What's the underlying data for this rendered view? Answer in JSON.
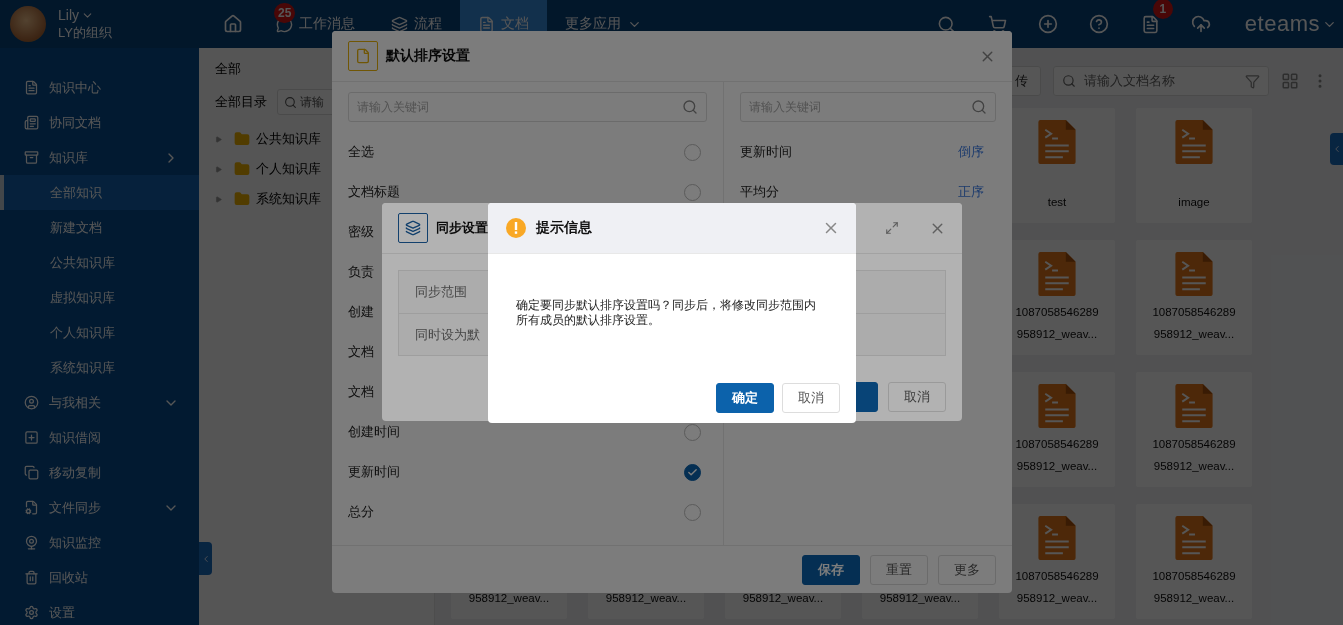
{
  "user": {
    "name": "Lily",
    "org": "LY的组织"
  },
  "nav": [
    {
      "label": "工作消息",
      "badge": "25",
      "selected": false,
      "kind": "link"
    },
    {
      "label": "流程",
      "selected": false,
      "kind": "link"
    },
    {
      "label": "文档",
      "selected": true,
      "kind": "link"
    },
    {
      "label": "更多应用",
      "selected": false,
      "kind": "menu"
    }
  ],
  "notification_badge": "1",
  "brand": "eteams",
  "sidebar": {
    "items": [
      {
        "label": "知识中心",
        "selected": false
      },
      {
        "label": "协同文档",
        "selected": false
      },
      {
        "label": "知识库",
        "selected": false,
        "expanded": true,
        "children": [
          {
            "label": "全部知识",
            "selected": true
          },
          {
            "label": "新建文档",
            "selected": false
          },
          {
            "label": "公共知识库",
            "selected": false
          },
          {
            "label": "虚拟知识库",
            "selected": false
          },
          {
            "label": "个人知识库",
            "selected": false
          },
          {
            "label": "系统知识库",
            "selected": false
          }
        ]
      },
      {
        "label": "与我相关",
        "selected": false,
        "expanded": false
      },
      {
        "label": "知识借阅",
        "selected": false
      },
      {
        "label": "移动复制",
        "selected": false
      },
      {
        "label": "文件同步",
        "selected": false,
        "expanded": false
      },
      {
        "label": "知识监控",
        "selected": false
      },
      {
        "label": "回收站",
        "selected": false
      },
      {
        "label": "设置",
        "selected": false
      }
    ]
  },
  "tree": {
    "title": "全部",
    "label": "全部目录",
    "search_placeholder": "请输",
    "items": [
      {
        "label": "公共知识库",
        "expanded": false
      },
      {
        "label": "个人知识库",
        "expanded": false
      },
      {
        "label": "系统知识库",
        "expanded": false
      }
    ]
  },
  "file_toolbar": {
    "upload_button": "传",
    "search_placeholder": "请输入文档名称"
  },
  "file_grid": {
    "rows": [
      {
        "cards": [
          {
            "lines": [
              "test"
            ]
          },
          {
            "lines": [
              "image"
            ]
          }
        ]
      },
      {
        "cards": [
          {
            "lines": [
              "1087058546289",
              "958912_weav..."
            ]
          },
          {
            "lines": [
              "1087058546289",
              "958912_weav..."
            ]
          }
        ]
      },
      {
        "cards": [
          {
            "lines": [
              "1087058546289",
              "958912_weav..."
            ]
          },
          {
            "lines": [
              "1087058546289",
              "958912_weav..."
            ]
          }
        ]
      },
      {
        "cards": [
          {
            "lines": [
              "958912_weav..."
            ]
          },
          {
            "lines": [
              "958912_weav..."
            ]
          },
          {
            "lines": [
              "958912_weav..."
            ]
          },
          {
            "lines": [
              "958912_weav..."
            ]
          },
          {
            "lines": [
              "1087058546289",
              "958912_weav..."
            ]
          },
          {
            "lines": [
              "1087058546289",
              "958912_weav..."
            ]
          }
        ]
      }
    ]
  },
  "sort_dialog": {
    "title": "默认排序设置",
    "left_search_placeholder": "请输入关键词",
    "fields": [
      {
        "label": "全选",
        "checked": false
      },
      {
        "label": "文档标题",
        "checked": false
      },
      {
        "label": "密级"
      },
      {
        "label": "负责"
      },
      {
        "label": "创建"
      },
      {
        "label": "文档"
      },
      {
        "label": "文档"
      },
      {
        "label": "创建时间",
        "checked": false
      },
      {
        "label": "更新时间",
        "checked": true
      },
      {
        "label": "总分",
        "checked": false
      }
    ],
    "right_search_placeholder": "请输入关键词",
    "sort_rules": [
      {
        "label": "更新时间",
        "order": "倒序"
      },
      {
        "label": "平均分",
        "order": "正序"
      }
    ],
    "buttons": [
      {
        "label": "保存",
        "kind": "primary"
      },
      {
        "label": "重置",
        "kind": "default"
      },
      {
        "label": "更多",
        "kind": "default"
      }
    ]
  },
  "sync_dialog": {
    "title": "同步设置",
    "rows": [
      "同步范围",
      "同时设为默"
    ],
    "buttons": [
      {
        "kind": "primary"
      },
      {
        "label": "取消",
        "kind": "default"
      }
    ]
  },
  "prompt_dialog": {
    "title": "提示信息",
    "message": "确定要同步默认排序设置吗？同步后，将修改同步范围内所有成员的默认排序设置。",
    "buttons": [
      {
        "label": "确定",
        "kind": "primary"
      },
      {
        "label": "取消",
        "kind": "default"
      }
    ]
  }
}
